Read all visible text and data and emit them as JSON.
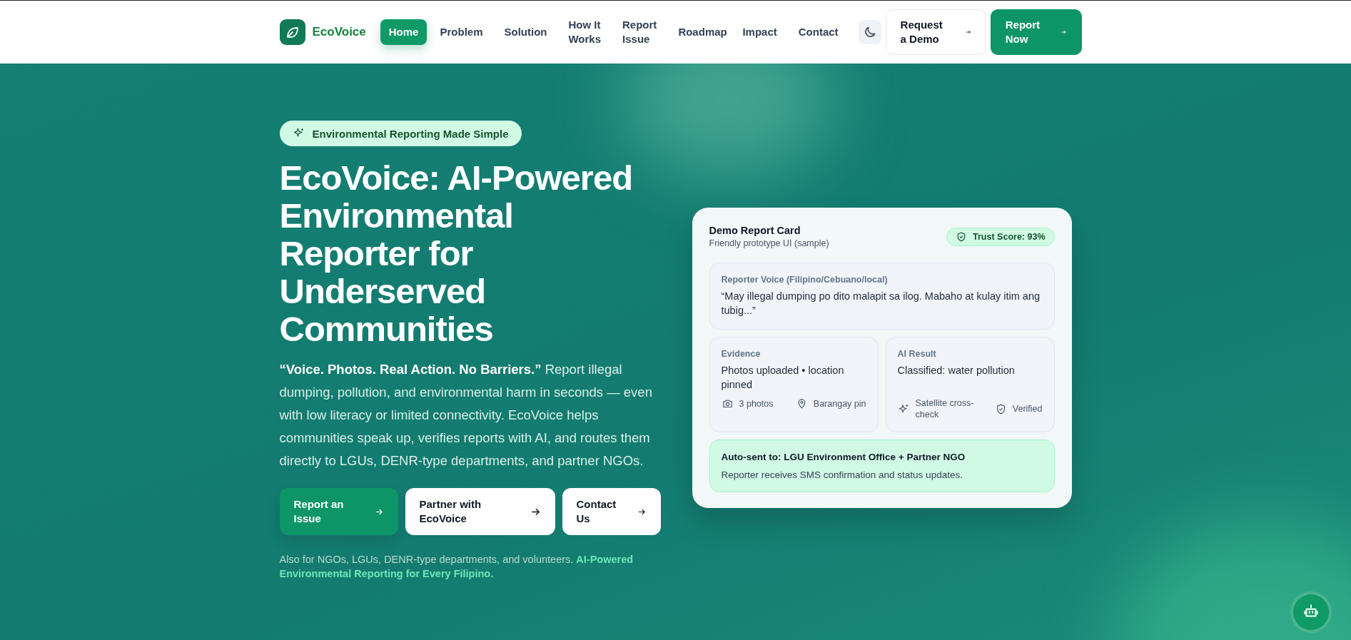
{
  "brand": {
    "name": "EcoVoice"
  },
  "nav": [
    {
      "label": "Home",
      "selected": true
    },
    {
      "label": "Problem",
      "selected": false
    },
    {
      "label": "Solution",
      "selected": false
    },
    {
      "label": "How It Works",
      "selected": false
    },
    {
      "label": "Report Issue",
      "selected": false
    },
    {
      "label": "Roadmap",
      "selected": false
    },
    {
      "label": "Impact",
      "selected": false
    },
    {
      "label": "Contact",
      "selected": false
    }
  ],
  "nav_buttons": [
    {
      "label": "Request a Demo",
      "kind": "secondary"
    },
    {
      "label": "Report Now",
      "kind": "primary"
    }
  ],
  "hero": {
    "badge": "Environmental Reporting Made Simple",
    "title": "EcoVoice: AI-Powered Environmental Reporter for Underserved Communities",
    "lead": "**“Voice. Photos. Real Action. No Barriers.”** Report illegal dumping, pollution, and environmental harm in seconds — even with low literacy or limited connectivity. EcoVoice helps communities speak up, verifies reports with AI, and routes them directly to LGUs, DENR-type departments, and partner NGOs.",
    "buttons": [
      {
        "label": "Report an Issue",
        "kind": "primary"
      },
      {
        "label": "Partner with EcoVoice",
        "kind": "secondary"
      },
      {
        "label": "Contact Us",
        "kind": "secondary"
      }
    ],
    "note": "Also for NGOs, LGUs, DENR-type departments, and volunteers.",
    "note_highlight": "AI-Powered Environmental Reporting for Every Filipino."
  },
  "card": {
    "title": "Demo Report Card",
    "subtitle": "Friendly prototype UI (sample)",
    "trust": "Trust Score: 93%",
    "voice": {
      "label": "Reporter Voice (Filipino/Cebuano/local)",
      "text": "“May illegal dumping po dito malapit sa ilog. Mabaho at kulay itim ang tubig...”"
    },
    "evidence": {
      "label": "Evidence",
      "text": "Photos uploaded • location pinned",
      "tags": [
        {
          "kind": "photos",
          "label": "3 photos"
        },
        {
          "kind": "pin",
          "label": "Barangay pin"
        }
      ]
    },
    "ai": {
      "label": "AI Result",
      "text": "Classified: water pollution",
      "tags": [
        {
          "kind": "satellite",
          "label": "Satellite cross-check"
        },
        {
          "kind": "verified",
          "label": "Verified"
        }
      ]
    },
    "routing": {
      "title": "Auto-sent to: LGU Environment Office + Partner NGO",
      "text": "Reporter receives SMS confirmation and status updates."
    }
  }
}
